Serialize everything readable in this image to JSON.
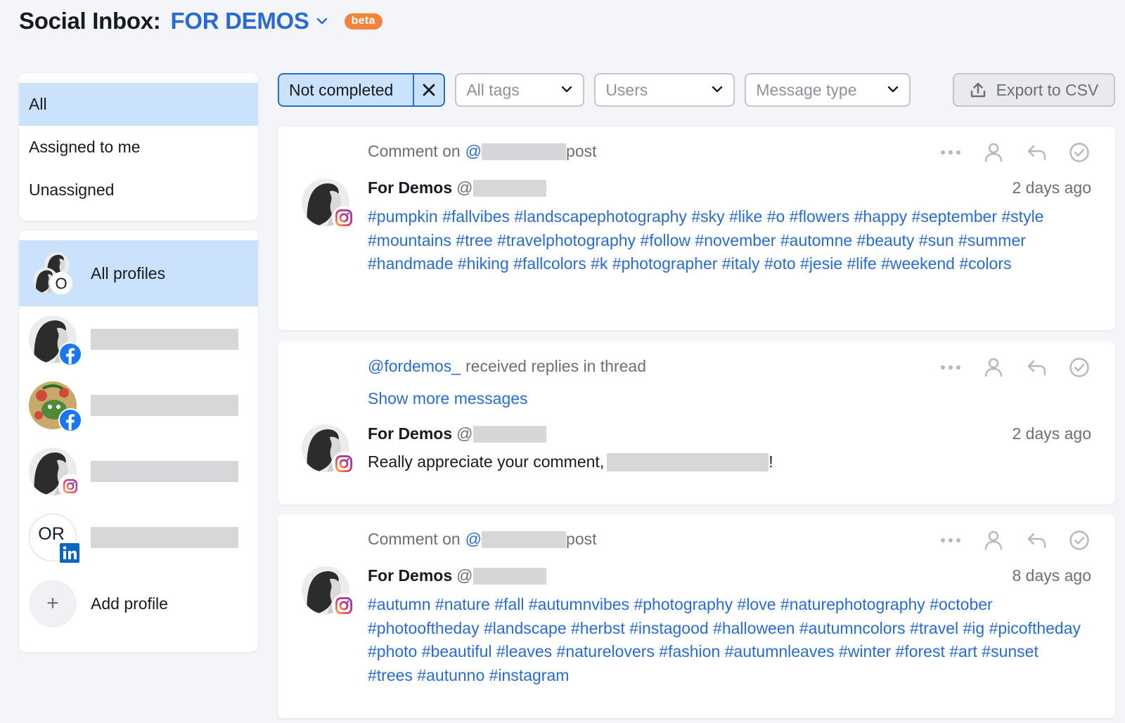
{
  "header": {
    "title": "Social Inbox:",
    "project": "FOR DEMOS",
    "badge": "beta"
  },
  "filters": [
    {
      "label": "All",
      "active": true
    },
    {
      "label": "Assigned to me",
      "active": false
    },
    {
      "label": "Unassigned",
      "active": false
    }
  ],
  "profiles": {
    "all_label": "All profiles",
    "all_overlay_letter": "O",
    "linkedin_initials": "OR",
    "add_label": "Add profile",
    "add_symbol": "+"
  },
  "toolbar": {
    "status_chip": "Not completed",
    "tags_placeholder": "All tags",
    "users_placeholder": "Users",
    "type_placeholder": "Message type",
    "export_label": "Export to CSV"
  },
  "messages": [
    {
      "head_prefix": "Comment on",
      "head_at": "@",
      "head_suffix": "post",
      "author": "For Demos",
      "author_at": "@",
      "time": "2 days ago",
      "text": "#pumpkin #fallvibes #landscapephotography #sky #like #o #flowers #happy #september #style #mountains #tree #travelphotography #follow #november #automne #beauty #sun #summer #handmade #hiking #fallcolors #k #photographer #italy #oto #jesie #life #weekend #colors"
    },
    {
      "head_handle": "@fordemos_",
      "head_suffix": "received replies in thread",
      "show_more": "Show more messages",
      "author": "For Demos",
      "author_at": "@",
      "time": "2 days ago",
      "text_prefix": "Really appreciate your comment,",
      "text_suffix": "!"
    },
    {
      "head_prefix": "Comment on",
      "head_at": "@",
      "head_suffix": "post",
      "author": "For Demos",
      "author_at": "@",
      "time": "8 days ago",
      "text": "#autumn #nature #fall #autumnvibes #photography #love #naturephotography #october #photooftheday #landscape #herbst #instagood #halloween #autumncolors #travel #ig #picoftheday #photo #beautiful #leaves #naturelovers #fashion #autumnleaves #winter #forest #art #sunset #trees #autunno #instagram"
    }
  ],
  "colors": {
    "accent": "#2a6bd1",
    "selected_bg": "#cbe2fc",
    "beta": "#f2833a",
    "facebook": "#1877f2",
    "linkedin": "#0a66c2"
  }
}
